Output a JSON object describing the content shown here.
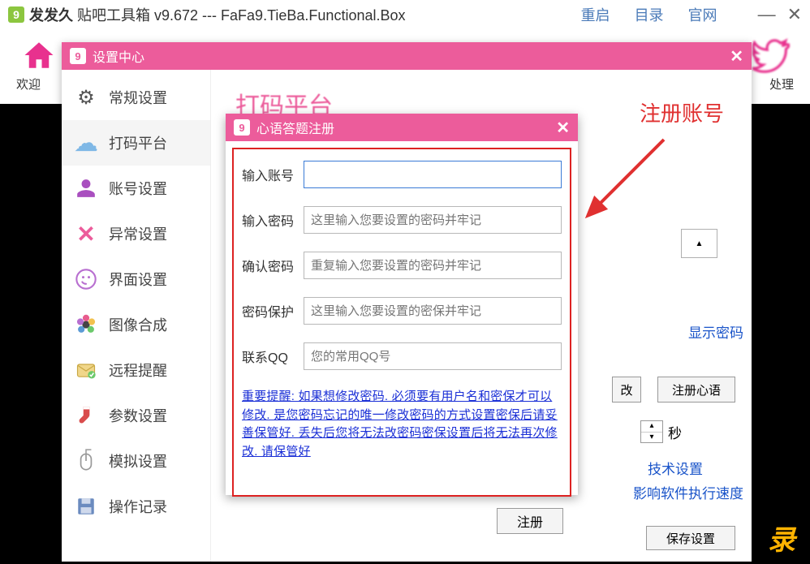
{
  "titlebar": {
    "app": "发发久",
    "suffix": "贴吧工具箱 v9.672 --- FaFa9.TieBa.Functional.Box",
    "links": {
      "restart": "重启",
      "catalog": "目录",
      "official": "官网"
    }
  },
  "toolbar": {
    "welcome": "欢迎",
    "right_label": "处理"
  },
  "settings_dialog": {
    "title": "设置中心",
    "nav": {
      "general": "常规设置",
      "dama": "打码平台",
      "account": "账号设置",
      "exception": "异常设置",
      "interface": "界面设置",
      "image": "图像合成",
      "remote": "远程提醒",
      "params": "参数设置",
      "simulate": "模拟设置",
      "oprec": "操作记录"
    },
    "content": {
      "heading": "打码平台",
      "dropdown_caret": "▲",
      "show_pw": "显示密码",
      "btn_modify": "改",
      "btn_register": "注册心语",
      "sec_unit": "秒",
      "link_tech": "技术设置",
      "link_speed": "影响软件执行速度",
      "save": "保存设置"
    }
  },
  "register_dialog": {
    "title": "心语答题注册",
    "rows": {
      "account": "输入账号",
      "password": "输入密码",
      "confirm": "确认密码",
      "protect": "密码保护",
      "qq": "联系QQ"
    },
    "placeholders": {
      "password": "这里输入您要设置的密码并牢记",
      "confirm": "重复输入您要设置的密码并牢记",
      "protect": "这里输入您要设置的密保并牢记",
      "qq": "您的常用QQ号"
    },
    "note": "重要提醒: 如果想修改密码. 必须要有用户名和密保才可以修改. 是您密码忘记的唯一修改密码的方式设置密保后请妥善保管好. 丢失后您将无法改密码密保设置后将无法再次修改. 请保管好",
    "submit": "注册"
  },
  "annotation": {
    "label": "注册账号"
  },
  "corner": {
    "text": "录"
  },
  "colors": {
    "brand": "#ec5c9b",
    "link": "#1a54c9",
    "danger": "#d22"
  }
}
